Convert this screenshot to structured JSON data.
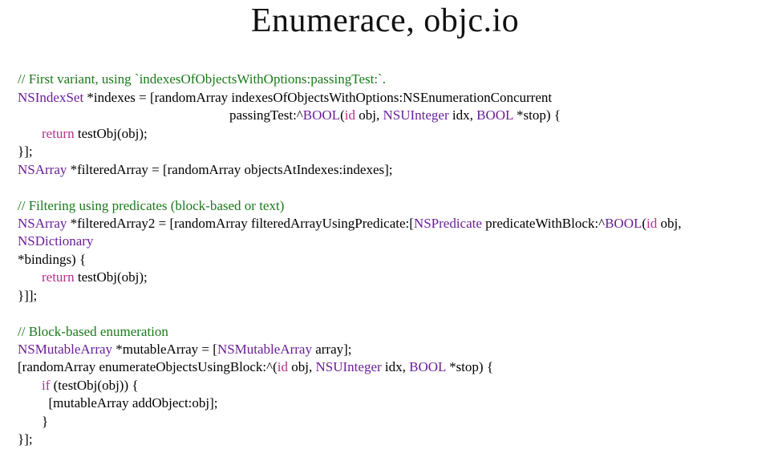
{
  "title": "Enumerace, objc.io",
  "code": {
    "c1": "// First variant, using `indexesOfObjectsWithOptions:passingTest:`.",
    "l2a": "NSIndexSet",
    "l2b": " *indexes = [randomArray indexesOfObjectsWithOptions:NSEnumerationConcurrent",
    "l3a": "passingTest:^",
    "l3b": "BOOL",
    "l3c": "(",
    "l3d": "id",
    "l3e": " obj, ",
    "l3f": "NSUInteger",
    "l3g": " idx, ",
    "l3h": "BOOL",
    "l3i": " *stop) {",
    "l4a": "return",
    "l4b": " testObj(obj);",
    "l5": "}];",
    "l6a": "NSArray",
    "l6b": " *filteredArray = [randomArray objectsAtIndexes:indexes];",
    "c2": "// Filtering using predicates (block-based or text)",
    "l8a": "NSArray",
    "l8b": " *filteredArray2 = [randomArray filteredArrayUsingPredicate:[",
    "l8c": "NSPredicate",
    "l8d": " predicateWithBlock:^",
    "l8e": "BOOL",
    "l8f": "(",
    "l8g": "id",
    "l8h": " obj, ",
    "l8i": "NSDictionary",
    "l9": "*bindings) {",
    "l10a": "return",
    "l10b": " testObj(obj);",
    "l11": "}]];",
    "c3": "// Block-based enumeration",
    "l13a": "NSMutableArray",
    "l13b": " *mutableArray = [",
    "l13c": "NSMutableArray",
    "l13d": " array];",
    "l14a": "[randomArray enumerateObjectsUsingBlock:^(",
    "l14b": "id",
    "l14c": " obj, ",
    "l14d": "NSUInteger",
    "l14e": " idx, ",
    "l14f": "BOOL",
    "l14g": " *stop) {",
    "l15a": "if",
    "l15b": " (testObj(obj)) {",
    "l16": "[mutableArray addObject:obj];",
    "l17": "}",
    "l18": "}];"
  }
}
